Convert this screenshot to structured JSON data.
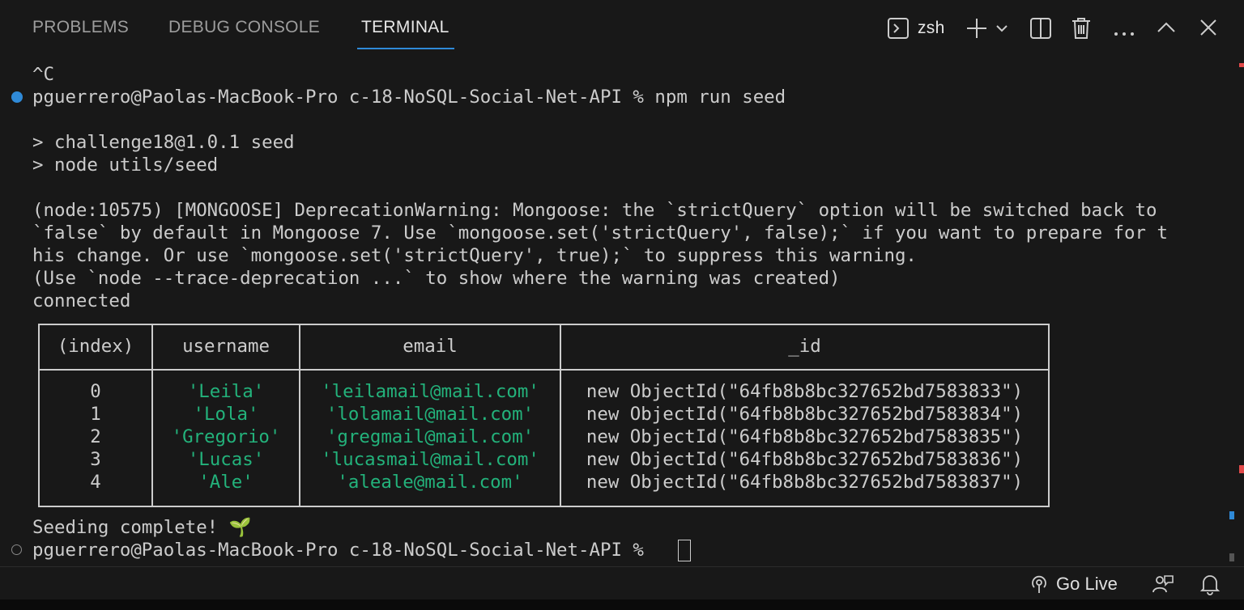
{
  "tabs": [
    {
      "label": "PROBLEMS"
    },
    {
      "label": "DEBUG CONSOLE"
    },
    {
      "label": "TERMINAL"
    }
  ],
  "toolbar": {
    "shell_label": "zsh",
    "icons": [
      "terminal-icon",
      "plus-icon",
      "chevron-down-icon",
      "split-icon",
      "trash-icon",
      "ellipsis-icon",
      "chevron-up-icon",
      "close-icon"
    ]
  },
  "terminal": {
    "line_interrupt": "^C",
    "prompt": "pguerrero@Paolas-MacBook-Pro c-18-NoSQL-Social-Net-API % npm run seed",
    "npm_line1": "> challenge18@1.0.1 seed",
    "npm_line2": "> node utils/seed",
    "warn1": "(node:10575) [MONGOOSE] DeprecationWarning: Mongoose: the `strictQuery` option will be switched back to",
    "warn2": "`false` by default in Mongoose 7. Use `mongoose.set('strictQuery', false);` if you want to prepare for t",
    "warn3": "his change. Or use `mongoose.set('strictQuery', true);` to suppress this warning.",
    "warn4": "(Use `node --trace-deprecation ...` to show where the warning was created)",
    "connected": "connected",
    "seeding": "Seeding complete! 🌱",
    "final_prompt": "pguerrero@Paolas-MacBook-Pro c-18-NoSQL-Social-Net-API % "
  },
  "table": {
    "headers": [
      "(index)",
      "username",
      "email",
      "_id"
    ],
    "rows": [
      {
        "index": "0",
        "username": "'Leila'",
        "email": "'leilamail@mail.com'",
        "id": "new ObjectId(\"64fb8b8bc327652bd7583833\")"
      },
      {
        "index": "1",
        "username": "'Lola'",
        "email": "'lolamail@mail.com'",
        "id": "new ObjectId(\"64fb8b8bc327652bd7583834\")"
      },
      {
        "index": "2",
        "username": "'Gregorio'",
        "email": "'gregmail@mail.com'",
        "id": "new ObjectId(\"64fb8b8bc327652bd7583835\")"
      },
      {
        "index": "3",
        "username": "'Lucas'",
        "email": "'lucasmail@mail.com'",
        "id": "new ObjectId(\"64fb8b8bc327652bd7583836\")"
      },
      {
        "index": "4",
        "username": "'Ale'",
        "email": "'aleale@mail.com'",
        "id": "new ObjectId(\"64fb8b8bc327652bd7583837\")"
      }
    ]
  },
  "statusbar": {
    "go_live": "Go Live"
  },
  "colors": {
    "accent": "#2f8ad8",
    "string_green": "#23b27b",
    "background": "#181818"
  }
}
